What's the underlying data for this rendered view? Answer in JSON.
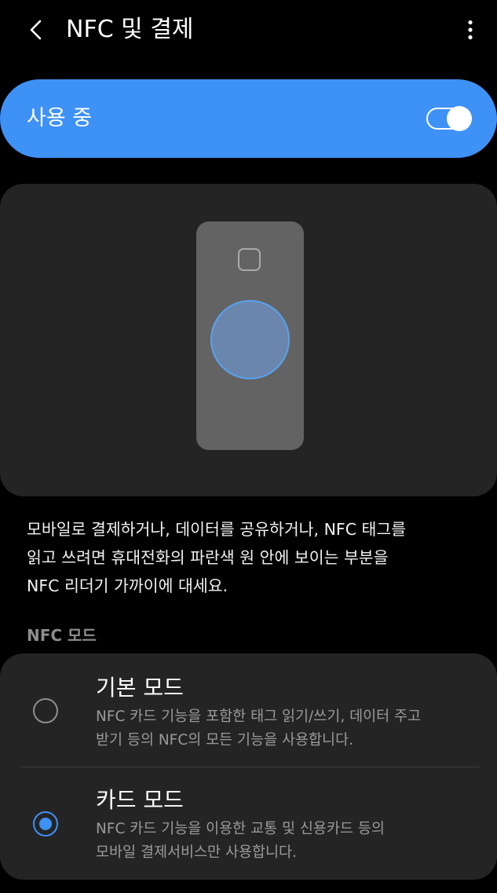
{
  "header": {
    "title": "NFC 및 결제",
    "back_icon": "chevron-left-icon",
    "more_icon": "more-vertical-icon"
  },
  "master_switch": {
    "label": "사용 중",
    "enabled": true,
    "accent_color": "#3e91f5"
  },
  "illustration": {
    "phone_icon": "phone-back-icon",
    "nfc_area_color": "#6a86ad"
  },
  "description": {
    "lines": [
      "모바일로 결제하거나, 데이터를 공유하거나, NFC 태그를",
      "읽고 쓰려면 휴대전화의 파란색 원 안에 보이는 부분을",
      "NFC 리더기 가까이에 대세요."
    ]
  },
  "nfc_mode": {
    "section_label": "NFC 모드",
    "selected": "card",
    "options": [
      {
        "id": "default",
        "title": "기본 모드",
        "desc_lines": [
          "NFC 카드 기능을 포함한 태그 읽기/쓰기, 데이터 주고",
          "받기 등의 NFC의 모든 기능을 사용합니다."
        ],
        "checked": false
      },
      {
        "id": "card",
        "title": "카드 모드",
        "desc_lines": [
          "NFC 카드 기능을 이용한 교통 및 신용카드 등의",
          "모바일 결제서비스만 사용합니다."
        ],
        "checked": true
      }
    ]
  }
}
